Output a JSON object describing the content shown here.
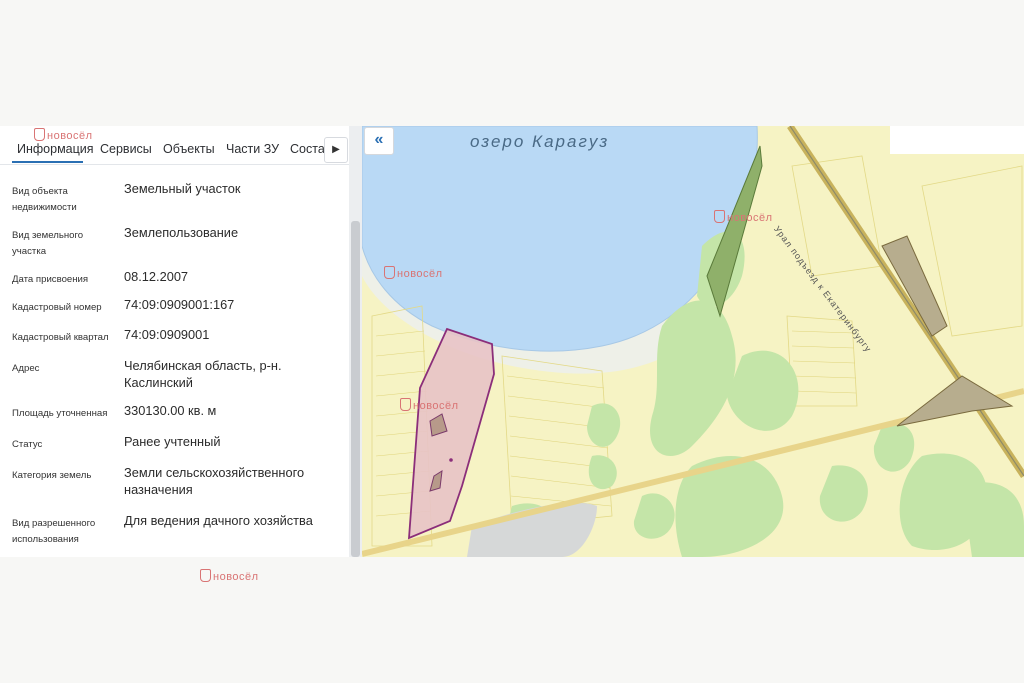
{
  "tabs": {
    "info": "Информация",
    "services": "Сервисы",
    "objects": "Объекты",
    "parts": "Части ЗУ",
    "composition": "Состав",
    "next_icon": "chevron-right-icon"
  },
  "attributes": [
    {
      "label": "Вид объекта недвижимости",
      "value": "Земельный участок"
    },
    {
      "label": "Вид земельного участка",
      "value": "Землепользование"
    },
    {
      "label": "Дата присвоения",
      "value": "08.12.2007"
    },
    {
      "label": "Кадастровый номер",
      "value": "74:09:0909001:167"
    },
    {
      "label": "Кадастровый квартал",
      "value": "74:09:0909001"
    },
    {
      "label": "Адрес",
      "value": "Челябинская область, р-н. Каслинский"
    },
    {
      "label": "Площадь уточненная",
      "value": "330130.00 кв. м"
    },
    {
      "label": "Статус",
      "value": "Ранее учтенный"
    },
    {
      "label": "Категория земель",
      "value": "Земли сельскохозяйственного назначения"
    },
    {
      "label": "Вид разрешенного использования",
      "value": "Для ведения дачного хозяйства"
    }
  ],
  "map": {
    "lake_label": "озеро Карагуз",
    "road_label": "Урал   подъезд к Екатеринбургу",
    "collapse_icon": "double-chevron-left-icon",
    "colors": {
      "water": "#b9d9f5",
      "land": "#f6f3c4",
      "forest": "#c4e5a8",
      "parcel_fill": "#e8c3c6",
      "parcel_stroke": "#8b2e7a",
      "road": "#e8d48a"
    }
  },
  "watermark": {
    "text": "новосёл"
  }
}
